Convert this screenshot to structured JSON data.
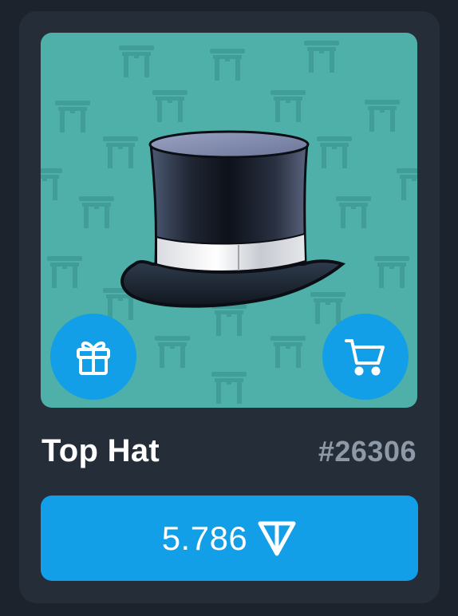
{
  "item": {
    "title": "Top Hat",
    "number": "#26306"
  },
  "buy": {
    "price": "5.786",
    "currency_icon": "ton-diamond-icon"
  },
  "actions": {
    "gift_icon": "gift-icon",
    "cart_icon": "cart-icon"
  },
  "colors": {
    "page_bg": "#1c232c",
    "card_bg": "#242d38",
    "art_bg": "#4fb0aa",
    "pattern": "#3d9892",
    "accent": "#139ee8",
    "title": "#ffffff",
    "number": "#8e99a8"
  }
}
